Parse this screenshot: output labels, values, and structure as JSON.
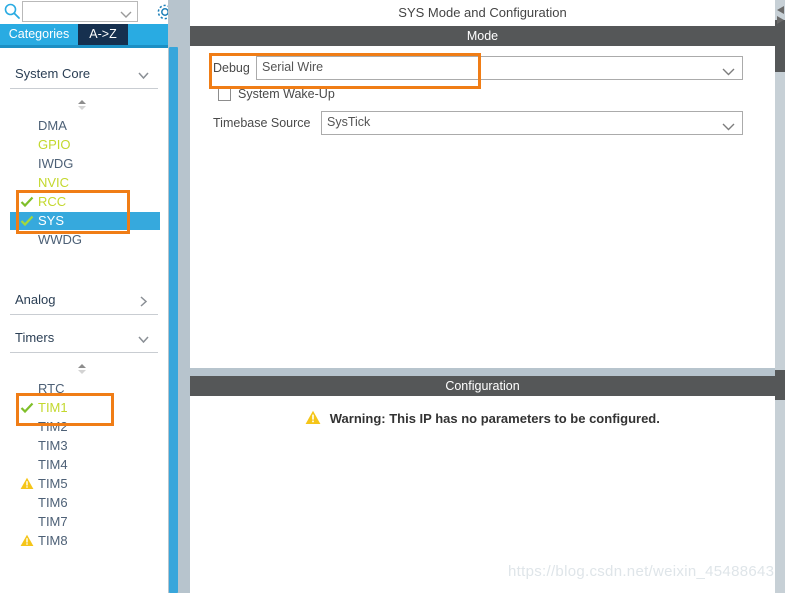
{
  "sidebar": {
    "search": {
      "value": "",
      "placeholder": ""
    },
    "search_icon": "search-icon",
    "settings_icon": "gear-icon",
    "tabs": [
      {
        "label": "Categories",
        "active": true
      },
      {
        "label": "A->Z",
        "active": false
      }
    ],
    "groups": [
      {
        "title": "System Core",
        "expanded": true,
        "chevron": "chevron-down-icon",
        "items": [
          {
            "label": "DMA",
            "state": "default",
            "color": "#4d6076"
          },
          {
            "label": "GPIO",
            "state": "configured",
            "color": "#c3d82e"
          },
          {
            "label": "IWDG",
            "state": "default",
            "color": "#4d6076"
          },
          {
            "label": "NVIC",
            "state": "configured",
            "color": "#c3d82e"
          },
          {
            "label": "RCC",
            "state": "checked",
            "color": "#c3d82e"
          },
          {
            "label": "SYS",
            "state": "checked-selected",
            "color": "#ffffff"
          },
          {
            "label": "WWDG",
            "state": "default",
            "color": "#4d6076"
          }
        ]
      },
      {
        "title": "Analog",
        "expanded": false,
        "chevron": "chevron-right-icon",
        "items": []
      },
      {
        "title": "Timers",
        "expanded": true,
        "chevron": "chevron-down-icon",
        "items": [
          {
            "label": "RTC",
            "state": "default",
            "color": "#4d6076"
          },
          {
            "label": "TIM1",
            "state": "checked",
            "color": "#c3d82e"
          },
          {
            "label": "TIM2",
            "state": "default",
            "color": "#4d6076"
          },
          {
            "label": "TIM3",
            "state": "default",
            "color": "#4d6076"
          },
          {
            "label": "TIM4",
            "state": "default",
            "color": "#4d6076"
          },
          {
            "label": "TIM5",
            "state": "warning",
            "color": "#4d6076"
          },
          {
            "label": "TIM6",
            "state": "default",
            "color": "#4d6076"
          },
          {
            "label": "TIM7",
            "state": "default",
            "color": "#4d6076"
          },
          {
            "label": "TIM8",
            "state": "warning",
            "color": "#4d6076"
          }
        ]
      }
    ]
  },
  "main": {
    "title": "SYS Mode and Configuration",
    "mode_section": {
      "header": "Mode",
      "debug_label": "Debug",
      "debug_value": "Serial Wire",
      "wakeup_label": "System Wake-Up",
      "wakeup_checked": false,
      "timebase_label": "Timebase Source",
      "timebase_value": "SysTick"
    },
    "config_section": {
      "header": "Configuration",
      "warning_text": "Warning: This IP has no parameters to be configured.",
      "warning_icon": "warning-triangle-icon"
    }
  },
  "watermark": "https://blog.csdn.net/weixin_45488643",
  "colors": {
    "accent_blue": "#29abe2",
    "tab_dark": "#16304f",
    "highlight_orange": "#f07d16",
    "selected_row": "#36a9dd",
    "configured_green": "#c3d82e",
    "section_bar": "#555758",
    "warning_yellow": "#f5c518",
    "panel_gap": "#b7c4cd"
  }
}
